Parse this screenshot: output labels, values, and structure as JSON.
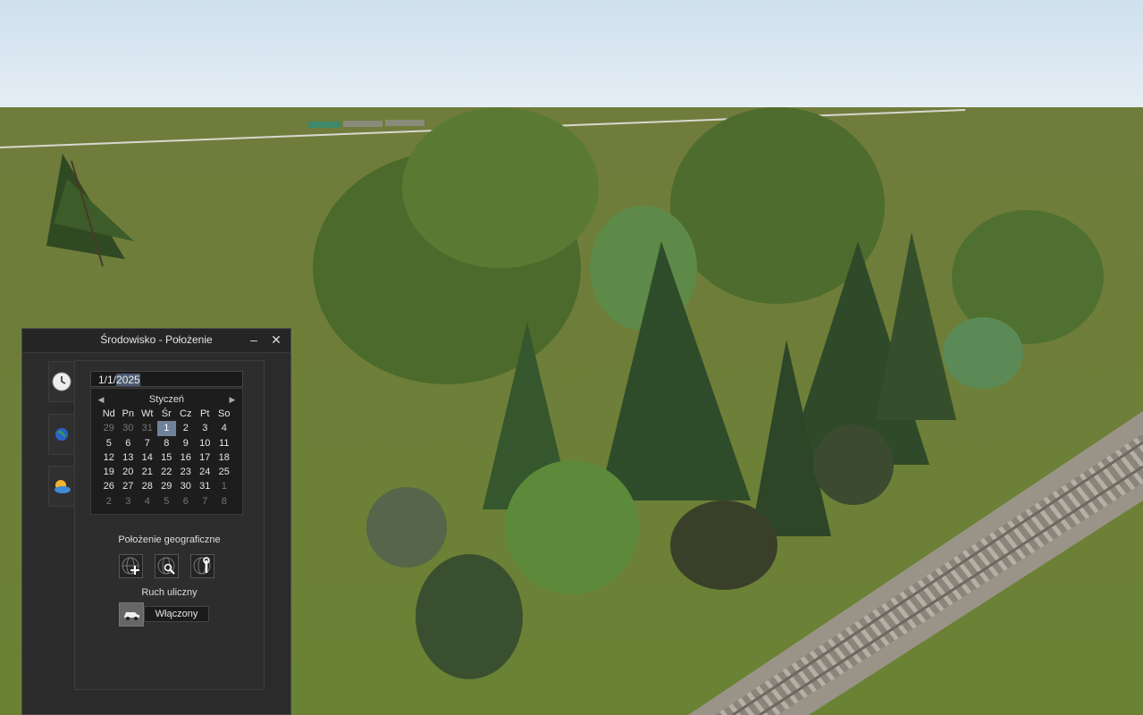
{
  "window": {
    "title": "Środowisko - Położenie",
    "minimize_label": "–",
    "close_label": "✕"
  },
  "side_tabs": [
    {
      "icon": "clock-icon"
    },
    {
      "icon": "globe-icon"
    },
    {
      "icon": "weather-icon"
    }
  ],
  "date_field": {
    "day_month": "1/1/",
    "year": "2025"
  },
  "calendar": {
    "month": "Styczeń",
    "prev_label": "◀",
    "next_label": "▶",
    "weekdays": [
      "Nd",
      "Pn",
      "Wt",
      "Śr",
      "Cz",
      "Pt",
      "So"
    ],
    "weeks": [
      [
        "29",
        "30",
        "31",
        "1",
        "2",
        "3",
        "4"
      ],
      [
        "5",
        "6",
        "7",
        "8",
        "9",
        "10",
        "11"
      ],
      [
        "12",
        "13",
        "14",
        "15",
        "16",
        "17",
        "18"
      ],
      [
        "19",
        "20",
        "21",
        "22",
        "23",
        "24",
        "25"
      ],
      [
        "26",
        "27",
        "28",
        "29",
        "30",
        "31",
        "1"
      ],
      [
        "2",
        "3",
        "4",
        "5",
        "6",
        "7",
        "8"
      ]
    ],
    "selected": "1"
  },
  "geo": {
    "label": "Położenie geograficzne",
    "buttons": [
      {
        "icon": "globe-add-icon"
      },
      {
        "icon": "globe-search-icon"
      },
      {
        "icon": "globe-settings-icon"
      }
    ]
  },
  "traffic": {
    "label": "Ruch uliczny",
    "icon": "car-icon",
    "value": "Włączony"
  },
  "colors": {
    "sky_top": "#c9dcea",
    "ground": "#6e7e3a",
    "panel_bg": "#2b2b2b",
    "selected_day": "#6f829a"
  }
}
